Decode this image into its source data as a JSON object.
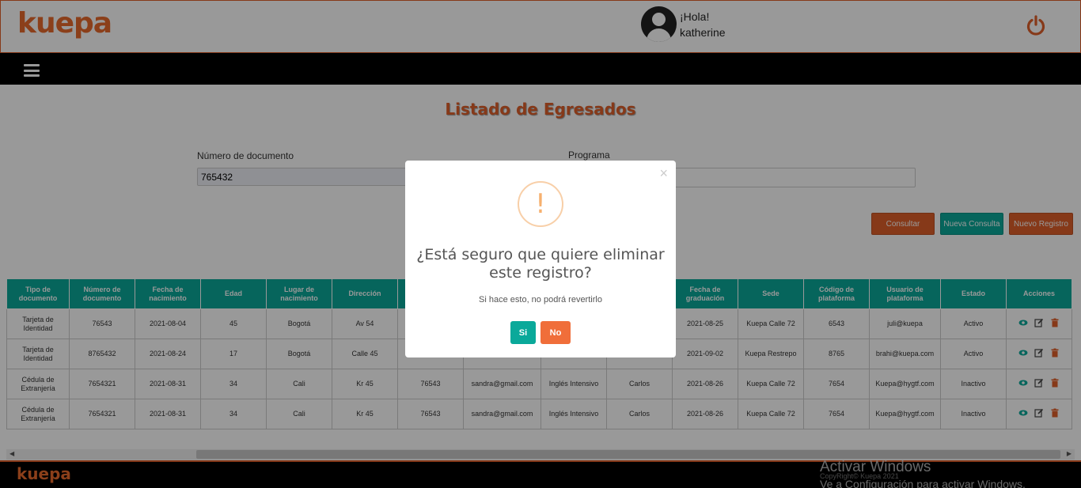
{
  "brand": {
    "logo_text": "kuepa",
    "accent": "#e0602a",
    "teal": "#0aa99a"
  },
  "header": {
    "greeting": "¡Hola!",
    "username": "katherine",
    "power_icon": "power-icon",
    "avatar_icon": "user-avatar-icon"
  },
  "nav": {
    "menu_icon": "hamburger-icon"
  },
  "page_title": "Listado de Egresados",
  "form": {
    "doc_label": "Número de documento",
    "doc_value": "765432",
    "program_label": "Programa",
    "program_value": ""
  },
  "buttons": {
    "consultar": "Consultar",
    "nueva_consulta": "Nueva Consulta",
    "nuevo_registro": "Nuevo Registro"
  },
  "table": {
    "headers": [
      "Tipo de documento",
      "Número de documento",
      "Fecha de nacimiento",
      "Edad",
      "Lugar de nacimiento",
      "Dirección",
      "",
      "",
      "",
      "",
      "Fecha de graduación",
      "Sede",
      "Código de plataforma",
      "Usuario de plataforma",
      "Estado",
      "Acciones"
    ],
    "rows": [
      [
        "Tarjeta de Identidad",
        "76543",
        "2021-08-04",
        "45",
        "Bogotá",
        "Av 54",
        "",
        "",
        "",
        "",
        "2021-08-25",
        "Kuepa Calle 72",
        "6543",
        "juli@kuepa",
        "Activo"
      ],
      [
        "Tarjeta de Identidad",
        "8765432",
        "2021-08-24",
        "17",
        "Bogotá",
        "Calle 45",
        "",
        "",
        "",
        "",
        "2021-09-02",
        "Kuepa Restrepo",
        "8765",
        "brahi@kuepa.com",
        "Activo"
      ],
      [
        "Cédula de Extranjería",
        "7654321",
        "2021-08-31",
        "34",
        "Cali",
        "Kr 45",
        "76543",
        "sandra@gmail.com",
        "Inglés Intensivo",
        "Carlos",
        "2021-08-26",
        "Kuepa Calle 72",
        "7654",
        "Kuepa@hygtf.com",
        "Inactivo"
      ],
      [
        "Cédula de Extranjería",
        "7654321",
        "2021-08-31",
        "34",
        "Cali",
        "Kr 45",
        "76543",
        "sandra@gmail.com",
        "Inglés Intensivo",
        "Carlos",
        "2021-08-26",
        "Kuepa Calle 72",
        "7654",
        "Kuepa@hygtf.com",
        "Inactivo"
      ]
    ]
  },
  "footer": {
    "logo_text": "kuepa"
  },
  "watermark": {
    "line1": "Activar Windows",
    "copyright": "CopyRight© Kuepa 2021",
    "line2": "Ve a Configuración para activar Windows."
  },
  "modal": {
    "close": "×",
    "icon": "!",
    "title": "¿Está seguro que quiere eliminar este registro?",
    "subtitle": "Si hace esto, no podrá revertirlo",
    "yes": "Si",
    "no": "No"
  }
}
